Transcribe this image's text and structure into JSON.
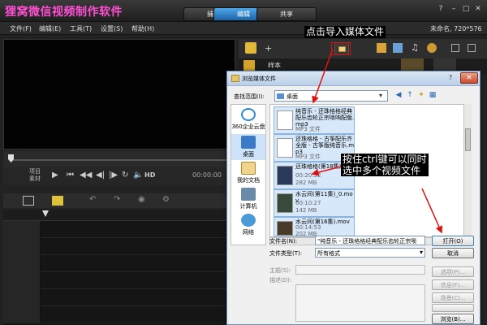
{
  "app": {
    "title": "狸窝微信视频制作软件",
    "tabs": [
      "捕获",
      "编辑",
      "共享"
    ],
    "active_tab": 1,
    "window_controls": [
      "?",
      "–",
      "□",
      "✕"
    ]
  },
  "menubar": {
    "items": [
      "文件(F)",
      "编辑(E)",
      "工具(T)",
      "设置(S)",
      "帮助(H)"
    ],
    "project_info": "未命名, 720*576"
  },
  "player": {
    "mode_labels": [
      "项目",
      "素材"
    ],
    "timecode": "00:00:00",
    "controls": [
      "play",
      "prev",
      "rewind",
      "step-back",
      "step-forward",
      "forward",
      "repeat",
      "volume",
      "HD"
    ]
  },
  "library": {
    "sample_label": "样本"
  },
  "dialog": {
    "title": "浏览媒体文件",
    "help": "?",
    "close": "✕",
    "look_in_label": "查找范围(I):",
    "look_in_value": "桌面",
    "places": [
      {
        "label": "360企业云盘",
        "icon": "cloud-icon"
      },
      {
        "label": "桌面",
        "icon": "desktop-icon"
      },
      {
        "label": "我的文档",
        "icon": "documents-icon"
      },
      {
        "label": "计算机",
        "icon": "computer-icon"
      },
      {
        "label": "网络",
        "icon": "network-icon"
      }
    ],
    "files": [
      {
        "name": "纯音乐 - 还珠格格经典配乐齿轮正宗唢呐配版.mp3",
        "meta": [
          "MP3 文件"
        ]
      },
      {
        "name": "还珠格格 - 古筝配乐齐全版 - 古筝版纯音乐.mp3",
        "meta": [
          "MP3 文件"
        ]
      },
      {
        "name": "还珠格格(第18集)...",
        "meta": [
          "00:20:32",
          "282 MB"
        ]
      },
      {
        "name": "水云间(第11集)_0.mov",
        "meta": [
          "00:10:27",
          "142 MB"
        ]
      },
      {
        "name": "水云间(第16集).mov",
        "meta": [
          "00:14:53",
          "202 MB"
        ]
      }
    ],
    "filename_label": "文件名(N):",
    "filename_value": "\"纯音乐 - 还珠格格经典配乐齿轮正宗唢",
    "filetype_label": "文件类型(T):",
    "filetype_value": "所有格式",
    "open_button": "打开(O)",
    "cancel_button": "取消",
    "subject_label": "主题(S):",
    "desc_label": "描述(D):",
    "side_buttons": [
      "选项(P)...",
      "信息(F)...",
      "场景(C)...",
      "",
      "浏览(B)..."
    ]
  },
  "annotations": {
    "import_hint": "点击导入媒体文件",
    "multi_select_hint_line1": "按住ctrl键可以同时",
    "multi_select_hint_line2": "选中多个视频文件"
  },
  "colors": {
    "title_text": "#ff4fd2",
    "active_tab": "#2b83d1",
    "annotation_arrow": "#e01010"
  }
}
